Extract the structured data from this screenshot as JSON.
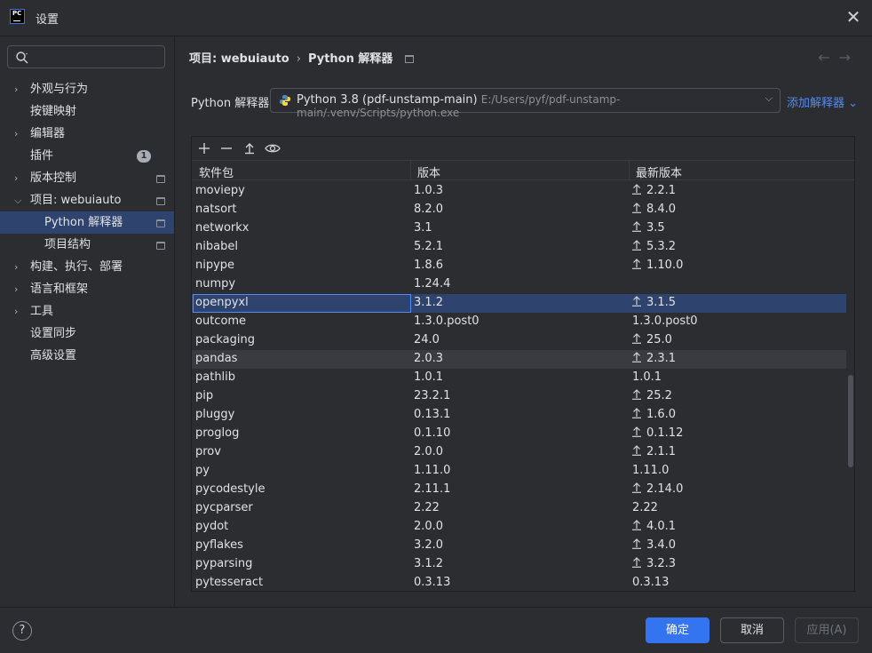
{
  "window": {
    "title": "设置"
  },
  "sidebar": {
    "search_placeholder": "",
    "items": [
      {
        "label": "外观与行为",
        "expandable": true
      },
      {
        "label": "按键映射"
      },
      {
        "label": "编辑器",
        "expandable": true
      },
      {
        "label": "插件",
        "badge": "1"
      },
      {
        "label": "版本控制",
        "expandable": true
      },
      {
        "label": "项目: webuiauto",
        "expanded": true
      },
      {
        "label": "Python 解释器",
        "selected": true
      },
      {
        "label": "项目结构"
      },
      {
        "label": "构建、执行、部署",
        "expandable": true
      },
      {
        "label": "语言和框架",
        "expandable": true
      },
      {
        "label": "工具",
        "expandable": true
      },
      {
        "label": "设置同步"
      },
      {
        "label": "高级设置"
      }
    ]
  },
  "breadcrumb": {
    "project": "项目: webuiauto",
    "page": "Python 解释器"
  },
  "interpreter": {
    "label": "Python 解释器:",
    "name": "Python 3.8 (pdf-unstamp-main)",
    "path": "E:/Users/pyf/pdf-unstamp-main/.venv/Scripts/python.exe",
    "add_label": "添加解释器"
  },
  "table": {
    "headers": [
      "软件包",
      "版本",
      "最新版本"
    ],
    "rows": [
      {
        "pkg": "moviepy",
        "ver": "1.0.3",
        "latest": "2.2.1",
        "upgrade": true
      },
      {
        "pkg": "natsort",
        "ver": "8.2.0",
        "latest": "8.4.0",
        "upgrade": true
      },
      {
        "pkg": "networkx",
        "ver": "3.1",
        "latest": "3.5",
        "upgrade": true
      },
      {
        "pkg": "nibabel",
        "ver": "5.2.1",
        "latest": "5.3.2",
        "upgrade": true
      },
      {
        "pkg": "nipype",
        "ver": "1.8.6",
        "latest": "1.10.0",
        "upgrade": true
      },
      {
        "pkg": "numpy",
        "ver": "1.24.4",
        "latest": "",
        "upgrade": false
      },
      {
        "pkg": "openpyxl",
        "ver": "3.1.2",
        "latest": "3.1.5",
        "upgrade": true
      },
      {
        "pkg": "outcome",
        "ver": "1.3.0.post0",
        "latest": "1.3.0.post0",
        "upgrade": false
      },
      {
        "pkg": "packaging",
        "ver": "24.0",
        "latest": "25.0",
        "upgrade": true
      },
      {
        "pkg": "pandas",
        "ver": "2.0.3",
        "latest": "2.3.1",
        "upgrade": true
      },
      {
        "pkg": "pathlib",
        "ver": "1.0.1",
        "latest": "1.0.1",
        "upgrade": false
      },
      {
        "pkg": "pip",
        "ver": "23.2.1",
        "latest": "25.2",
        "upgrade": true
      },
      {
        "pkg": "pluggy",
        "ver": "0.13.1",
        "latest": "1.6.0",
        "upgrade": true
      },
      {
        "pkg": "proglog",
        "ver": "0.1.10",
        "latest": "0.1.12",
        "upgrade": true
      },
      {
        "pkg": "prov",
        "ver": "2.0.0",
        "latest": "2.1.1",
        "upgrade": true
      },
      {
        "pkg": "py",
        "ver": "1.11.0",
        "latest": "1.11.0",
        "upgrade": false
      },
      {
        "pkg": "pycodestyle",
        "ver": "2.11.1",
        "latest": "2.14.0",
        "upgrade": true
      },
      {
        "pkg": "pycparser",
        "ver": "2.22",
        "latest": "2.22",
        "upgrade": false
      },
      {
        "pkg": "pydot",
        "ver": "2.0.0",
        "latest": "4.0.1",
        "upgrade": true
      },
      {
        "pkg": "pyflakes",
        "ver": "3.2.0",
        "latest": "3.4.0",
        "upgrade": true
      },
      {
        "pkg": "pyparsing",
        "ver": "3.1.2",
        "latest": "3.2.3",
        "upgrade": true
      },
      {
        "pkg": "pytesseract",
        "ver": "0.3.13",
        "latest": "0.3.13",
        "upgrade": false
      }
    ],
    "selected_pkg": "openpyxl",
    "hovered_pkg": "pandas"
  },
  "footer": {
    "help": "?",
    "ok": "确定",
    "cancel": "取消",
    "apply": "应用(A)"
  },
  "colors": {
    "accent": "#3574f0",
    "selection": "#2e436e",
    "link": "#548af7"
  }
}
